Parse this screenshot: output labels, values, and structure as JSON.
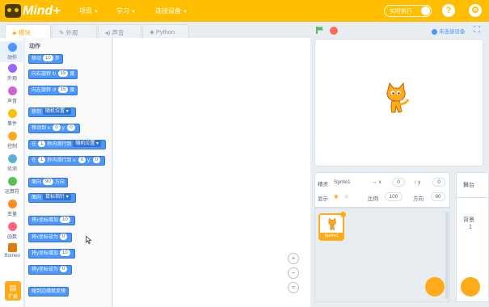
{
  "app": {
    "logo_text": "Mind+"
  },
  "menu": [
    {
      "label": "项目"
    },
    {
      "label": "学习"
    },
    {
      "label": "连接设备"
    }
  ],
  "realtime_label": "实时执行",
  "top_icons": {
    "help": "?",
    "settings": "⚙"
  },
  "tabs": [
    {
      "label": "模块",
      "icon": "puzzle-icon"
    },
    {
      "label": "外观",
      "icon": "brush-icon"
    },
    {
      "label": "声音",
      "icon": "speaker-icon"
    },
    {
      "label": "Python",
      "icon": "python-icon"
    }
  ],
  "connection_status": "未连接设备",
  "categories": [
    {
      "label": "动作",
      "color": "#4c97ff"
    },
    {
      "label": "外观",
      "color": "#9966ff"
    },
    {
      "label": "声音",
      "color": "#cf63cf"
    },
    {
      "label": "事件",
      "color": "#ffbf00"
    },
    {
      "label": "控制",
      "color": "#ffab19"
    },
    {
      "label": "侦测",
      "color": "#5cb1d6"
    },
    {
      "label": "运算符",
      "color": "#59c059"
    },
    {
      "label": "变量",
      "color": "#ff8c1a"
    },
    {
      "label": "函数",
      "color": "#ff6680"
    },
    {
      "label": "Romeo",
      "color": "#e07a10"
    }
  ],
  "extension_button": "扩展",
  "palette": {
    "title": "动作",
    "blocks": {
      "move": {
        "a": "移动",
        "v": "10",
        "b": "步"
      },
      "turn_right": {
        "a": "向右旋转 ↻",
        "v": "15",
        "b": "度"
      },
      "turn_left": {
        "a": "向左旋转 ↺",
        "v": "15",
        "b": "度"
      },
      "goto": {
        "a": "移到",
        "d": "随机位置"
      },
      "goto_xy": {
        "a": "移动到 x:",
        "x": "0",
        "b": "y:",
        "y": "0"
      },
      "glide": {
        "a": "在",
        "v": "1",
        "b": "秒内滑行到",
        "d": "随机位置"
      },
      "glide_xy": {
        "a": "在",
        "v": "1",
        "b": "秒内滑行到 x:",
        "x": "0",
        "c": "y:",
        "y": "0"
      },
      "point_dir": {
        "a": "面向",
        "v": "90",
        "b": "方向"
      },
      "point_towards": {
        "a": "面向",
        "d": "鼠标指针"
      },
      "change_x": {
        "a": "将x坐标增加",
        "v": "10"
      },
      "set_x": {
        "a": "将x坐标设为",
        "v": "0"
      },
      "change_y": {
        "a": "将y坐标增加",
        "v": "10"
      },
      "set_y": {
        "a": "将y坐标设为",
        "v": "0"
      },
      "bounce": {
        "a": "碰到边缘就反弹"
      }
    }
  },
  "zoom": {
    "in": "+",
    "out": "−",
    "reset": "="
  },
  "sprite_info": {
    "sprite_label": "精灵",
    "sprite_name": "Sprite1",
    "x_label": "x",
    "x": "0",
    "y_label": "y",
    "y": "0",
    "show_label": "显示",
    "size_label": "比例",
    "size": "100",
    "direction_label": "方向",
    "direction": "90"
  },
  "sprite_thumb": {
    "name": "Sprite1"
  },
  "stage_panel": {
    "title": "舞台",
    "backdrops_label": "背景",
    "backdrops_count": "1"
  }
}
